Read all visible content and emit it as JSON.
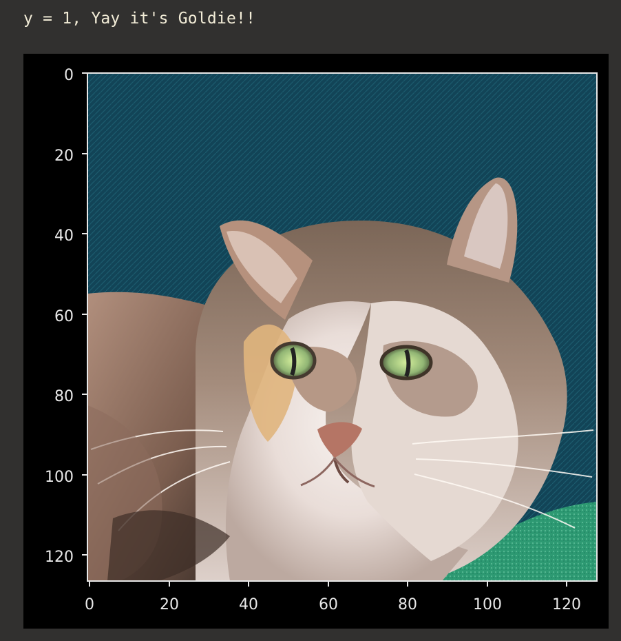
{
  "output": {
    "stdout_text": "y = 1, Yay it's Goldie!!"
  },
  "figure": {
    "background": "#000000",
    "axes_color": "#e8e8e8",
    "image_description_icon": "cat-photo",
    "x_ticks": [
      "0",
      "20",
      "40",
      "60",
      "80",
      "100",
      "120"
    ],
    "y_ticks": [
      "0",
      "20",
      "40",
      "60",
      "80",
      "100",
      "120"
    ]
  },
  "colors": {
    "page_bg": "#31302f",
    "stdout_text": "#f2ecd7",
    "teal_backdrop": "#15495a",
    "blanket_green": "#2f9b73",
    "fur_brown": "#8d6c58",
    "fur_white": "#ece6e2",
    "eye_green": "#a9c489"
  }
}
